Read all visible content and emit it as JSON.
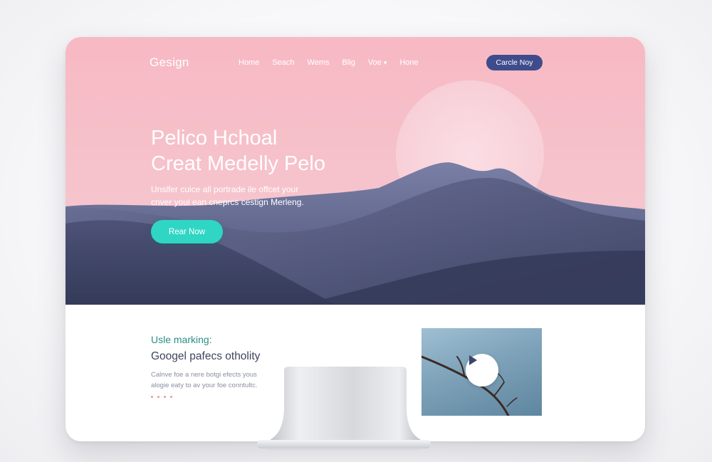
{
  "site": {
    "logo": "Gesign"
  },
  "nav": {
    "links": [
      {
        "label": "Home"
      },
      {
        "label": "Seach"
      },
      {
        "label": "Wems"
      },
      {
        "label": "Blig"
      },
      {
        "label": "Voe",
        "dropdown_icon": "chevron-down-icon"
      },
      {
        "label": "Hone"
      }
    ],
    "cta_label": "Carcle Noy"
  },
  "hero": {
    "title_lines": [
      "Pelico Hchoal",
      "Creat Medelly Pelo"
    ],
    "subtitle_lines": [
      "Unslfer cuice all portrade ile offcet your",
      "cnver youi ean cneprcs cestign Merleng."
    ],
    "button_label": "Rear Now"
  },
  "section": {
    "eyebrow": "Usle marking:",
    "title": "Googel pafecs otholity",
    "body_lines": [
      "Calnve foe a nere botgi efects yous",
      "alogie eaty to av your foe conntultc."
    ]
  },
  "video": {
    "icon": "play-icon"
  },
  "colors": {
    "hero_pink": "#f7b9c3",
    "cta_navy": "#3f4c8c",
    "accent_teal": "#2fd6c4",
    "eyebrow_teal": "#2c8e86",
    "mountain_navy": "#3a4060"
  }
}
